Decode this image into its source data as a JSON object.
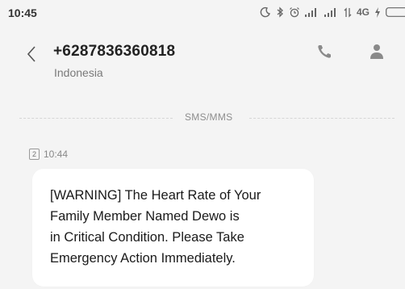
{
  "status_bar": {
    "time": "10:45",
    "network_type": "4G"
  },
  "header": {
    "contact_number": "+6287836360818",
    "country": "Indonesia"
  },
  "conversation": {
    "divider_label": "SMS/MMS",
    "messages": [
      {
        "sim_slot": "2",
        "time": "10:44",
        "text": "[WARNING] The Heart Rate of Your\nFamily Member Named Dewo is\nin Critical Condition. Please Take\nEmergency Action Immediately."
      }
    ]
  },
  "icons": {
    "back": "chevron-left-icon",
    "call": "phone-icon",
    "contact": "person-icon"
  },
  "colors": {
    "background": "#f4f4f4",
    "bubble": "#ffffff",
    "icon": "#8a8a8a"
  }
}
